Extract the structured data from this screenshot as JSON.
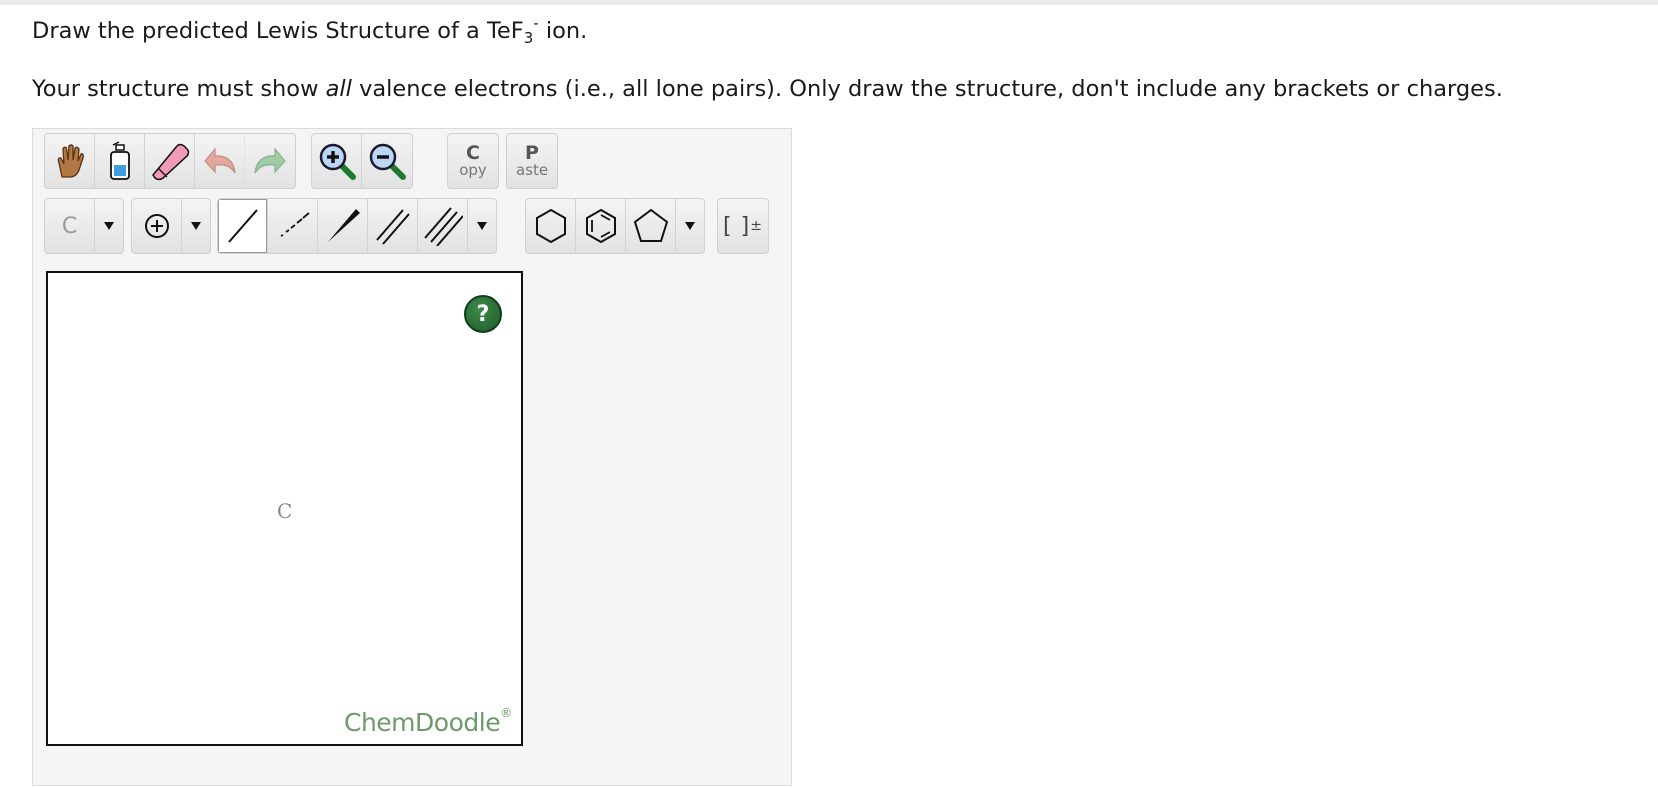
{
  "question": {
    "prefix": "Draw the predicted Lewis Structure of a TeF",
    "subscript": "3",
    "superscript": "-",
    "suffix": " ion."
  },
  "instructions": {
    "before_emphasis": "Your structure must show ",
    "emphasis": "all",
    "after_emphasis": " valence electrons (i.e., all lone pairs). Only draw the structure, don't include any brackets or charges."
  },
  "toolbar": {
    "copy_big": "C",
    "copy_small": "opy",
    "paste_big": "P",
    "paste_small": "aste",
    "atom_label": "C",
    "charge_label": "[ ]",
    "charge_sup": "±"
  },
  "canvas": {
    "help_label": "?",
    "atom_label": "C",
    "watermark": "ChemDoodle",
    "watermark_mark": "®"
  },
  "icons": [
    "hand-icon",
    "clear-bottle-icon",
    "eraser-icon",
    "undo-icon",
    "redo-icon",
    "zoom-in-icon",
    "zoom-out-icon",
    "charge-plus-icon",
    "single-bond-icon",
    "dashed-bond-icon",
    "wedge-bond-icon",
    "double-bond-icon",
    "triple-bond-icon",
    "hexagon-ring-icon",
    "benzene-ring-icon",
    "pentagon-ring-icon"
  ],
  "colors": {
    "help_button": "#2e7d3c",
    "watermark": "#6d9a6a",
    "eraser": "#e8739b"
  }
}
